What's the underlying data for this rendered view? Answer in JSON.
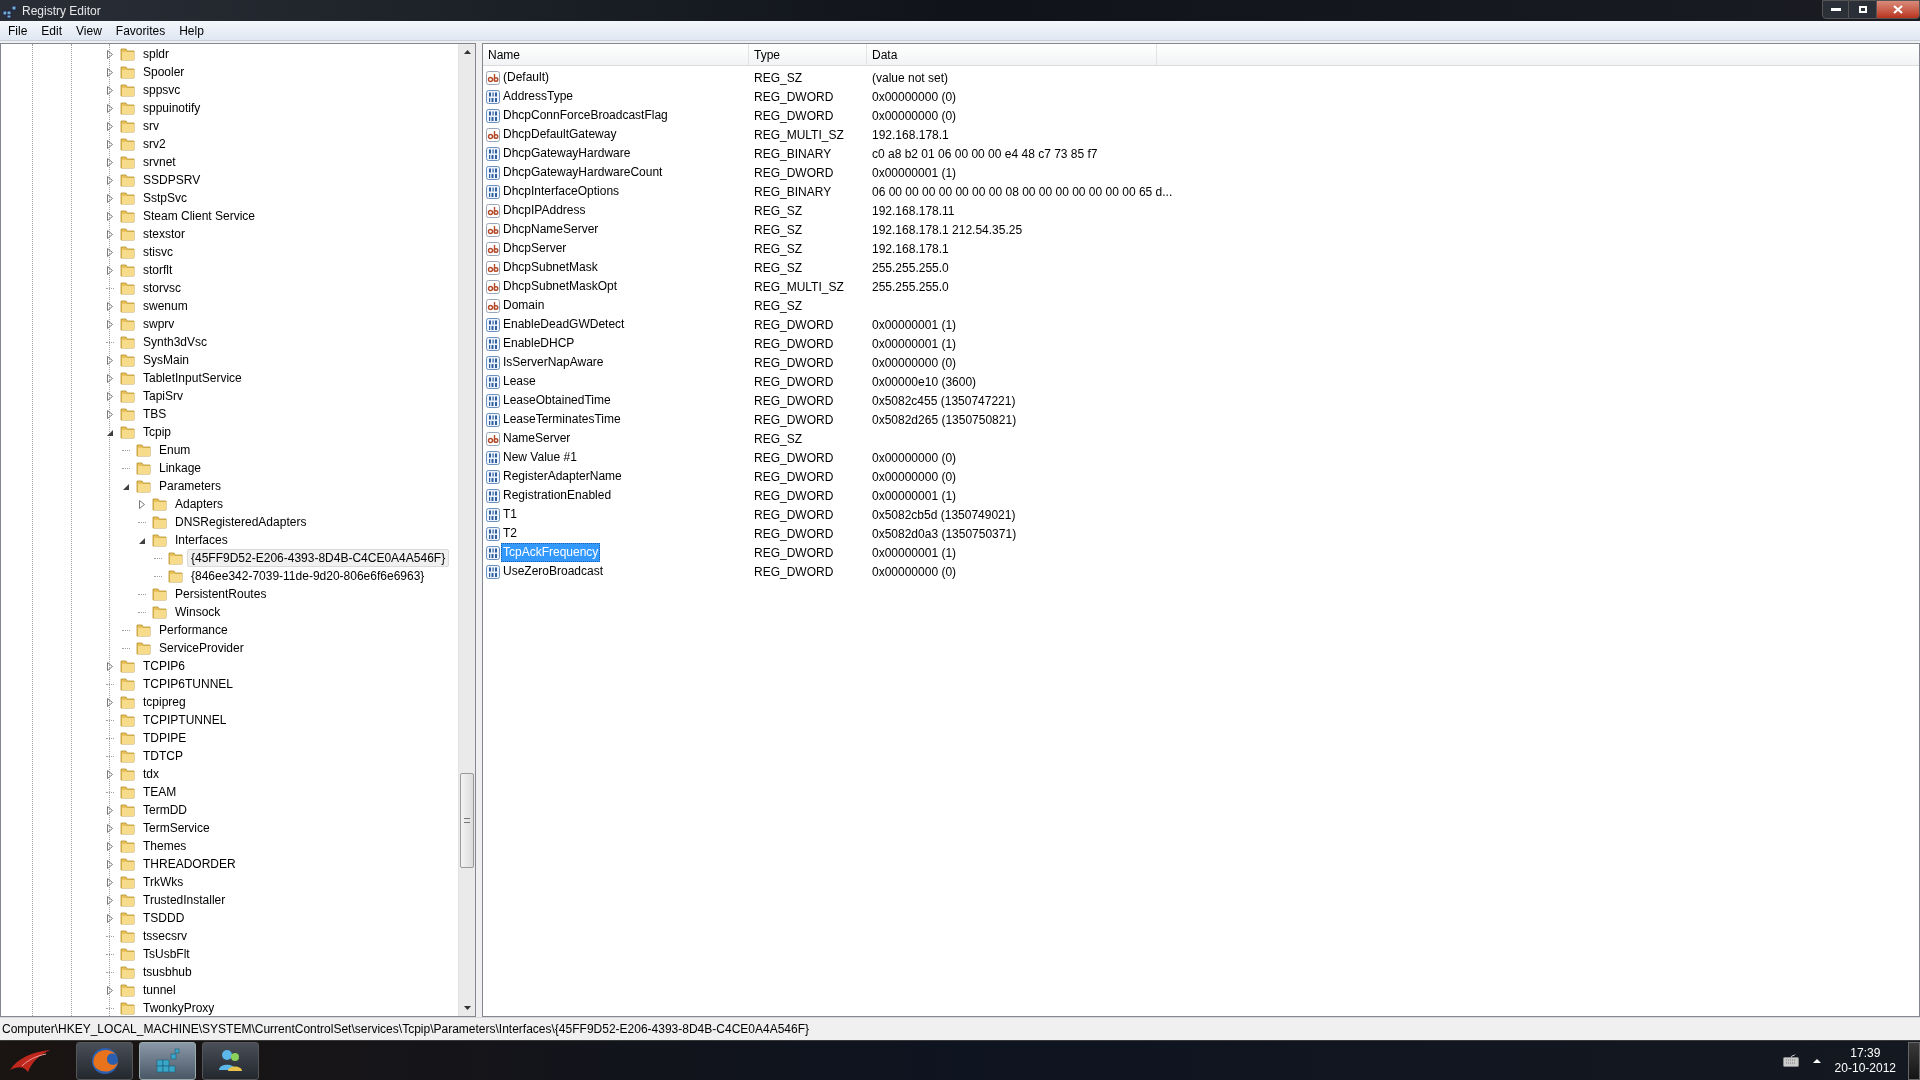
{
  "window": {
    "title": "Registry Editor"
  },
  "menu": [
    "File",
    "Edit",
    "View",
    "Favorites",
    "Help"
  ],
  "tree": {
    "items": [
      {
        "label": "spldr",
        "kind": "branch",
        "expanded": false,
        "selected": false
      },
      {
        "label": "Spooler",
        "kind": "branch",
        "expanded": false,
        "selected": false
      },
      {
        "label": "sppsvc",
        "kind": "branch",
        "expanded": false,
        "selected": false
      },
      {
        "label": "sppuinotify",
        "kind": "branch",
        "expanded": false,
        "selected": false
      },
      {
        "label": "srv",
        "kind": "branch",
        "expanded": false,
        "selected": false
      },
      {
        "label": "srv2",
        "kind": "branch",
        "expanded": false,
        "selected": false
      },
      {
        "label": "srvnet",
        "kind": "branch",
        "expanded": false,
        "selected": false
      },
      {
        "label": "SSDPSRV",
        "kind": "branch",
        "expanded": false,
        "selected": false
      },
      {
        "label": "SstpSvc",
        "kind": "branch",
        "expanded": false,
        "selected": false
      },
      {
        "label": "Steam Client Service",
        "kind": "branch",
        "expanded": false,
        "selected": false
      },
      {
        "label": "stexstor",
        "kind": "branch",
        "expanded": false,
        "selected": false
      },
      {
        "label": "stisvc",
        "kind": "branch",
        "expanded": false,
        "selected": false
      },
      {
        "label": "storflt",
        "kind": "branch",
        "expanded": false,
        "selected": false
      },
      {
        "label": "storvsc",
        "kind": "leaf",
        "selected": false
      },
      {
        "label": "swenum",
        "kind": "branch",
        "expanded": false,
        "selected": false
      },
      {
        "label": "swprv",
        "kind": "branch",
        "expanded": false,
        "selected": false
      },
      {
        "label": "Synth3dVsc",
        "kind": "leaf",
        "selected": false
      },
      {
        "label": "SysMain",
        "kind": "branch",
        "expanded": false,
        "selected": false
      },
      {
        "label": "TabletInputService",
        "kind": "branch",
        "expanded": false,
        "selected": false
      },
      {
        "label": "TapiSrv",
        "kind": "branch",
        "expanded": false,
        "selected": false
      },
      {
        "label": "TBS",
        "kind": "branch",
        "expanded": false,
        "selected": false
      },
      {
        "label": "Tcpip",
        "kind": "branch",
        "expanded": true,
        "selected": false,
        "children": [
          {
            "label": "Enum",
            "kind": "leaf",
            "selected": false
          },
          {
            "label": "Linkage",
            "kind": "leaf",
            "selected": false
          },
          {
            "label": "Parameters",
            "kind": "branch",
            "expanded": true,
            "selected": false,
            "children": [
              {
                "label": "Adapters",
                "kind": "branch",
                "expanded": false,
                "selected": false
              },
              {
                "label": "DNSRegisteredAdapters",
                "kind": "leaf",
                "selected": false
              },
              {
                "label": "Interfaces",
                "kind": "branch",
                "expanded": true,
                "selected": false,
                "children": [
                  {
                    "label": "{45FF9D52-E206-4393-8D4B-C4CE0A4A546F}",
                    "kind": "leaf",
                    "selected": true
                  },
                  {
                    "label": "{846ee342-7039-11de-9d20-806e6f6e6963}",
                    "kind": "leaf",
                    "selected": false
                  }
                ]
              },
              {
                "label": "PersistentRoutes",
                "kind": "leaf",
                "selected": false
              },
              {
                "label": "Winsock",
                "kind": "leaf",
                "selected": false
              }
            ]
          },
          {
            "label": "Performance",
            "kind": "leaf",
            "selected": false
          },
          {
            "label": "ServiceProvider",
            "kind": "leaf",
            "selected": false
          }
        ]
      },
      {
        "label": "TCPIP6",
        "kind": "branch",
        "expanded": false,
        "selected": false
      },
      {
        "label": "TCPIP6TUNNEL",
        "kind": "leaf",
        "selected": false
      },
      {
        "label": "tcpipreg",
        "kind": "branch",
        "expanded": false,
        "selected": false
      },
      {
        "label": "TCPIPTUNNEL",
        "kind": "leaf",
        "selected": false
      },
      {
        "label": "TDPIPE",
        "kind": "leaf",
        "selected": false
      },
      {
        "label": "TDTCP",
        "kind": "leaf",
        "selected": false
      },
      {
        "label": "tdx",
        "kind": "branch",
        "expanded": false,
        "selected": false
      },
      {
        "label": "TEAM",
        "kind": "leaf",
        "selected": false
      },
      {
        "label": "TermDD",
        "kind": "branch",
        "expanded": false,
        "selected": false
      },
      {
        "label": "TermService",
        "kind": "branch",
        "expanded": false,
        "selected": false
      },
      {
        "label": "Themes",
        "kind": "branch",
        "expanded": false,
        "selected": false
      },
      {
        "label": "THREADORDER",
        "kind": "branch",
        "expanded": false,
        "selected": false
      },
      {
        "label": "TrkWks",
        "kind": "branch",
        "expanded": false,
        "selected": false
      },
      {
        "label": "TrustedInstaller",
        "kind": "branch",
        "expanded": false,
        "selected": false
      },
      {
        "label": "TSDDD",
        "kind": "branch",
        "expanded": false,
        "selected": false
      },
      {
        "label": "tssecsrv",
        "kind": "leaf",
        "selected": false
      },
      {
        "label": "TsUsbFlt",
        "kind": "leaf",
        "selected": false
      },
      {
        "label": "tsusbhub",
        "kind": "leaf",
        "selected": false
      },
      {
        "label": "tunnel",
        "kind": "branch",
        "expanded": false,
        "selected": false
      },
      {
        "label": "TwonkyProxy",
        "kind": "leaf",
        "selected": false
      }
    ]
  },
  "values": {
    "columns": [
      "Name",
      "Type",
      "Data"
    ],
    "rows": [
      {
        "kind": "string",
        "name": "(Default)",
        "type": "REG_SZ",
        "data": "(value not set)",
        "selected": false
      },
      {
        "kind": "binary",
        "name": "AddressType",
        "type": "REG_DWORD",
        "data": "0x00000000 (0)",
        "selected": false
      },
      {
        "kind": "binary",
        "name": "DhcpConnForceBroadcastFlag",
        "type": "REG_DWORD",
        "data": "0x00000000 (0)",
        "selected": false
      },
      {
        "kind": "string",
        "name": "DhcpDefaultGateway",
        "type": "REG_MULTI_SZ",
        "data": "192.168.178.1",
        "selected": false
      },
      {
        "kind": "binary",
        "name": "DhcpGatewayHardware",
        "type": "REG_BINARY",
        "data": "c0 a8 b2 01 06 00 00 00 e4 48 c7 73 85 f7",
        "selected": false
      },
      {
        "kind": "binary",
        "name": "DhcpGatewayHardwareCount",
        "type": "REG_DWORD",
        "data": "0x00000001 (1)",
        "selected": false
      },
      {
        "kind": "binary",
        "name": "DhcpInterfaceOptions",
        "type": "REG_BINARY",
        "data": "06 00 00 00 00 00 00 00 08 00 00 00 00 00 00 00 65 d...",
        "selected": false
      },
      {
        "kind": "string",
        "name": "DhcpIPAddress",
        "type": "REG_SZ",
        "data": "192.168.178.11",
        "selected": false
      },
      {
        "kind": "string",
        "name": "DhcpNameServer",
        "type": "REG_SZ",
        "data": "192.168.178.1 212.54.35.25",
        "selected": false
      },
      {
        "kind": "string",
        "name": "DhcpServer",
        "type": "REG_SZ",
        "data": "192.168.178.1",
        "selected": false
      },
      {
        "kind": "string",
        "name": "DhcpSubnetMask",
        "type": "REG_SZ",
        "data": "255.255.255.0",
        "selected": false
      },
      {
        "kind": "string",
        "name": "DhcpSubnetMaskOpt",
        "type": "REG_MULTI_SZ",
        "data": "255.255.255.0",
        "selected": false
      },
      {
        "kind": "string",
        "name": "Domain",
        "type": "REG_SZ",
        "selected": false
      },
      {
        "kind": "binary",
        "name": "EnableDeadGWDetect",
        "type": "REG_DWORD",
        "data": "0x00000001 (1)",
        "selected": false
      },
      {
        "kind": "binary",
        "name": "EnableDHCP",
        "type": "REG_DWORD",
        "data": "0x00000001 (1)",
        "selected": false
      },
      {
        "kind": "binary",
        "name": "IsServerNapAware",
        "type": "REG_DWORD",
        "data": "0x00000000 (0)",
        "selected": false
      },
      {
        "kind": "binary",
        "name": "Lease",
        "type": "REG_DWORD",
        "data": "0x00000e10 (3600)",
        "selected": false
      },
      {
        "kind": "binary",
        "name": "LeaseObtainedTime",
        "type": "REG_DWORD",
        "data": "0x5082c455 (1350747221)",
        "selected": false
      },
      {
        "kind": "binary",
        "name": "LeaseTerminatesTime",
        "type": "REG_DWORD",
        "data": "0x5082d265 (1350750821)",
        "selected": false
      },
      {
        "kind": "string",
        "name": "NameServer",
        "type": "REG_SZ",
        "selected": false
      },
      {
        "kind": "binary",
        "name": "New Value #1",
        "type": "REG_DWORD",
        "data": "0x00000000 (0)",
        "selected": false
      },
      {
        "kind": "binary",
        "name": "RegisterAdapterName",
        "type": "REG_DWORD",
        "data": "0x00000000 (0)",
        "selected": false
      },
      {
        "kind": "binary",
        "name": "RegistrationEnabled",
        "type": "REG_DWORD",
        "data": "0x00000001 (1)",
        "selected": false
      },
      {
        "kind": "binary",
        "name": "T1",
        "type": "REG_DWORD",
        "data": "0x5082cb5d (1350749021)",
        "selected": false
      },
      {
        "kind": "binary",
        "name": "T2",
        "type": "REG_DWORD",
        "data": "0x5082d0a3 (1350750371)",
        "selected": false
      },
      {
        "kind": "binary",
        "name": "TcpAckFrequency",
        "type": "REG_DWORD",
        "data": "0x00000001 (1)",
        "selected": true
      },
      {
        "kind": "binary",
        "name": "UseZeroBroadcast",
        "type": "REG_DWORD",
        "data": "0x00000000 (0)",
        "selected": false
      }
    ]
  },
  "status_bar": "Computer\\HKEY_LOCAL_MACHINE\\SYSTEM\\CurrentControlSet\\services\\Tcpip\\Parameters\\Interfaces\\{45FF9D52-E206-4393-8D4B-C4CE0A4A546F}",
  "taskbar": {
    "apps": [
      {
        "kind": "browser",
        "selected": false
      },
      {
        "kind": "registry",
        "selected": true
      },
      {
        "kind": "messenger",
        "selected": false
      }
    ],
    "time": "17:39",
    "date": "20-10-2012"
  }
}
